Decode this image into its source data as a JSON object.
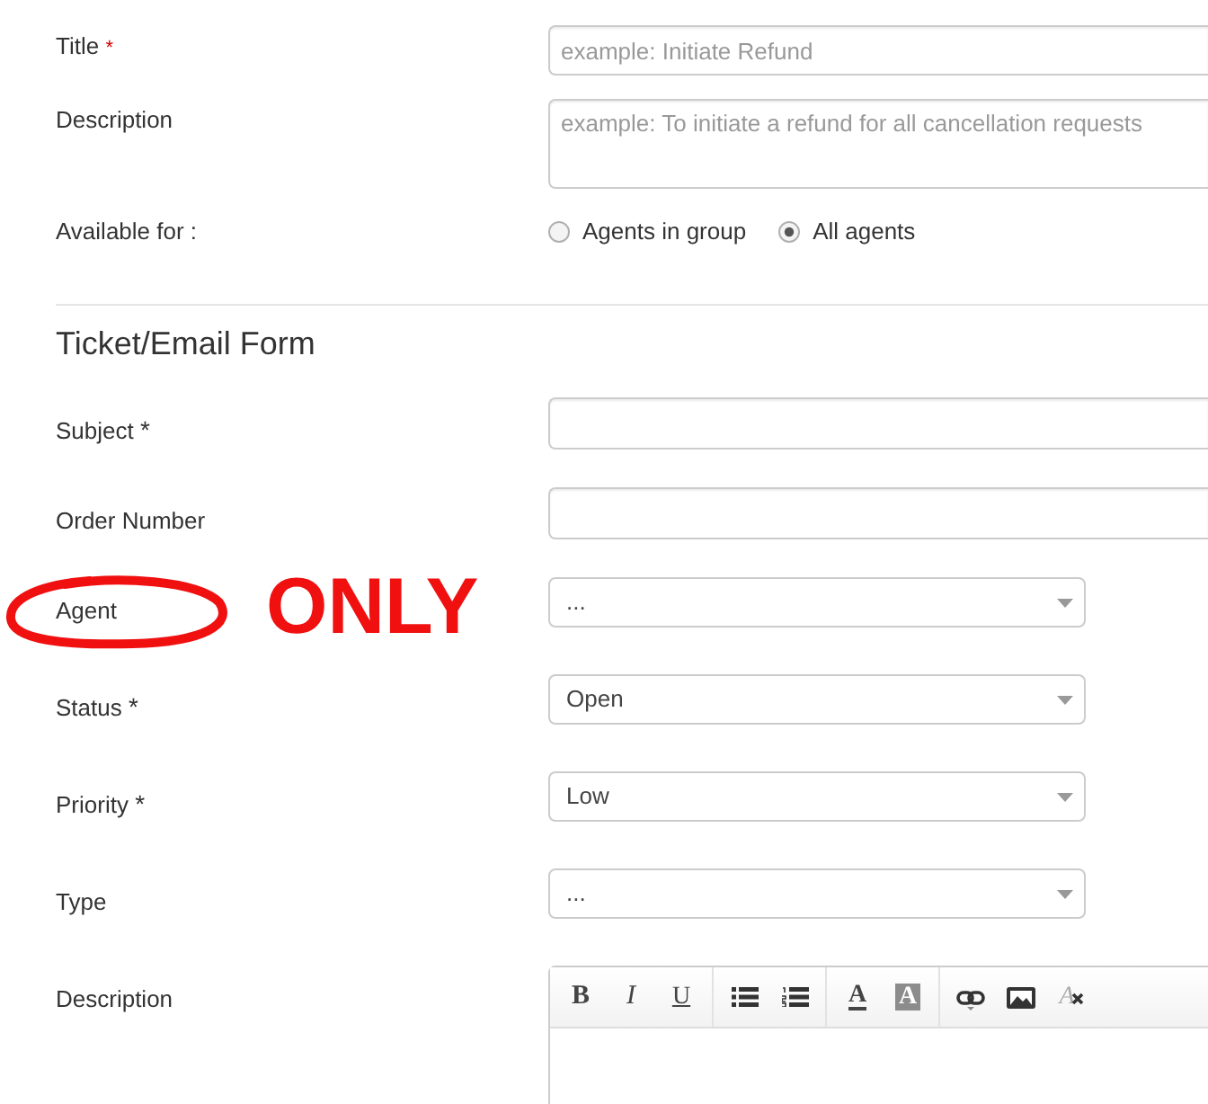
{
  "template_form": {
    "fields": [
      {
        "kind": "text",
        "label": "Title",
        "required_mark": "*",
        "placeholder": "example: Initiate Refund"
      },
      {
        "kind": "textarea",
        "label": "Description",
        "placeholder": "example: To initiate a refund for all cancellation requests"
      },
      {
        "kind": "radio",
        "label": "Available for :",
        "options": [
          {
            "label": "Agents in group",
            "selected": false
          },
          {
            "label": "All agents",
            "selected": true
          }
        ]
      }
    ]
  },
  "ticket_form": {
    "heading": "Ticket/Email Form",
    "fields": [
      {
        "kind": "text",
        "label": "Subject",
        "required_mark": "*",
        "circled": false
      },
      {
        "kind": "text",
        "label": "Order Number",
        "circled": false
      },
      {
        "kind": "select",
        "label": "Agent",
        "value": "...",
        "circled": true
      },
      {
        "kind": "select",
        "label": "Status",
        "required_mark": "*",
        "value": "Open",
        "circled": false
      },
      {
        "kind": "select",
        "label": "Priority",
        "required_mark": "*",
        "value": "Low",
        "circled": false
      },
      {
        "kind": "select",
        "label": "Type",
        "value": "...",
        "circled": false
      },
      {
        "kind": "editor",
        "label": "Description",
        "circled": false,
        "toolbar": [
          [
            {
              "kind": "bold",
              "label": "B"
            },
            {
              "kind": "italic",
              "label": "I"
            },
            {
              "kind": "underline",
              "label": "U"
            }
          ],
          [
            {
              "kind": "bullet_list"
            },
            {
              "kind": "numbered_list"
            }
          ],
          [
            {
              "kind": "text_color",
              "label": "A"
            },
            {
              "kind": "background_color",
              "label": "A"
            }
          ],
          [
            {
              "kind": "link"
            },
            {
              "kind": "image"
            },
            {
              "kind": "clear_format",
              "label": "A"
            }
          ]
        ]
      }
    ]
  },
  "annotation": {
    "text": "ONLY"
  }
}
